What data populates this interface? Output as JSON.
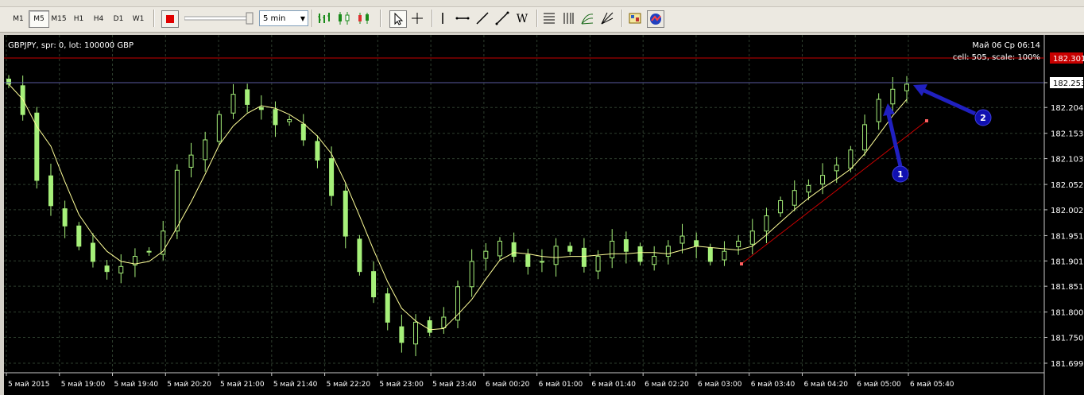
{
  "toolbar": {
    "timeframes": [
      "M1",
      "M5",
      "M15",
      "H1",
      "H4",
      "D1",
      "W1"
    ],
    "active_timeframe": "M5",
    "period": "5 min",
    "tool_w_label": "W"
  },
  "chart": {
    "symbol_info": "GBPJPY, spr: 0, lot: 100000 GBP",
    "datetime": "Май 06 Ср 06:14",
    "cell_scale": "cell: 505, scale: 100%",
    "red_level_label": "182.301",
    "current_price_label": "182.253",
    "colors": {
      "background": "#000000",
      "candle": "#a6f07a",
      "ma_line": "#ffff99",
      "red_level": "#c80000",
      "price_line": "#5a5aa0",
      "annotation": "#2020c0"
    },
    "annotations": [
      {
        "number": "1"
      },
      {
        "number": "2"
      }
    ]
  },
  "chart_data": {
    "type": "candlestick",
    "symbol": "GBPJPY",
    "timeframe": "M5",
    "y_tick_labels": [
      "182.253",
      "182.204",
      "182.153",
      "182.103",
      "182.052",
      "182.002",
      "181.951",
      "181.901",
      "181.851",
      "181.800",
      "181.750",
      "181.699"
    ],
    "ylim": [
      181.699,
      182.301
    ],
    "x_tick_labels": [
      "5 май 2015",
      "5 май 19:00",
      "5 май 19:40",
      "5 май 20:20",
      "5 май 21:00",
      "5 май 21:40",
      "5 май 22:20",
      "5 май 23:00",
      "5 май 23:40",
      "6 май 00:20",
      "6 май 01:00",
      "6 май 01:40",
      "6 май 02:20",
      "6 май 03:00",
      "6 май 03:40",
      "6 май 04:20",
      "6 май 05:00",
      "6 май 05:40"
    ],
    "close": [
      182.25,
      182.19,
      182.06,
      182.01,
      181.97,
      181.93,
      181.9,
      181.88,
      181.89,
      181.91,
      181.92,
      181.96,
      182.08,
      182.11,
      182.14,
      182.19,
      182.23,
      182.21,
      182.2,
      182.17,
      182.18,
      182.14,
      182.1,
      182.03,
      181.95,
      181.88,
      181.83,
      181.78,
      181.74,
      181.78,
      181.76,
      181.79,
      181.85,
      181.9,
      181.92,
      181.94,
      181.91,
      181.89,
      181.9,
      181.93,
      181.92,
      181.89,
      181.91,
      181.94,
      181.92,
      181.9,
      181.91,
      181.93,
      181.95,
      181.93,
      181.9,
      181.92,
      181.94,
      181.96,
      181.99,
      182.02,
      182.04,
      182.05,
      182.07,
      182.09,
      182.12,
      182.17,
      182.22,
      182.24,
      182.25
    ],
    "moving_average": {
      "color": "#ffff99"
    },
    "horizontal_levels": [
      {
        "value": 182.301,
        "color": "#c80000",
        "label": "182.301"
      },
      {
        "value": 182.253,
        "color": "#5a5aa0",
        "label": "182.253"
      }
    ],
    "trendline": {
      "color": "#c80000",
      "from": [
        "6 май 03:40",
        181.895
      ],
      "to": [
        "6 май 05:40",
        182.178
      ]
    }
  }
}
